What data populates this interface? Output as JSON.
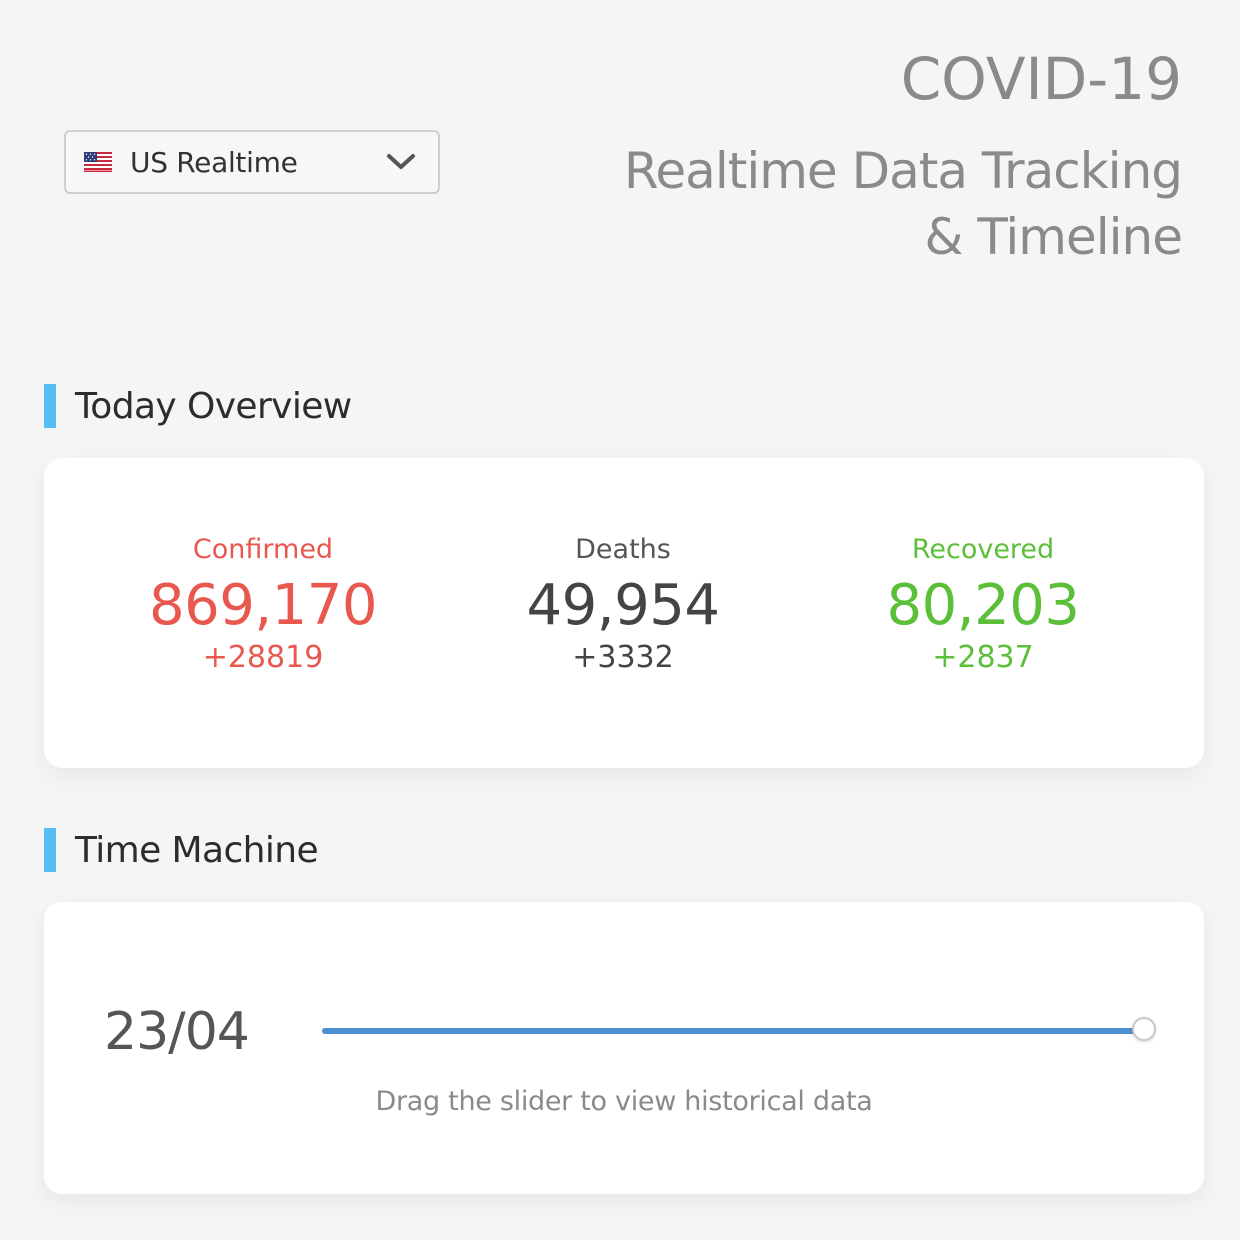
{
  "header": {
    "region_select": {
      "flag_icon": "us-flag-icon",
      "label": "US Realtime",
      "chevron_icon": "chevron-down-icon"
    },
    "title": "COVID-19",
    "subtitle": "Realtime Data Tracking & Timeline"
  },
  "overview": {
    "heading": "Today Overview",
    "stats": [
      {
        "label": "Confirmed",
        "value": "869,170",
        "delta": "+28819",
        "color": "#e8584f"
      },
      {
        "label": "Deaths",
        "value": "49,954",
        "delta": "+3332",
        "color": "#444444"
      },
      {
        "label": "Recovered",
        "value": "80,203",
        "delta": "+2837",
        "color": "#5cbf3a"
      }
    ]
  },
  "time_machine": {
    "heading": "Time Machine",
    "date": "23/04",
    "slider_level": 1.0,
    "hint": "Drag the slider to view historical data"
  },
  "colors": {
    "accent_bar": "#57bdf2",
    "slider_fill": "#4a90d0",
    "title_gray": "#8a8a8a"
  }
}
